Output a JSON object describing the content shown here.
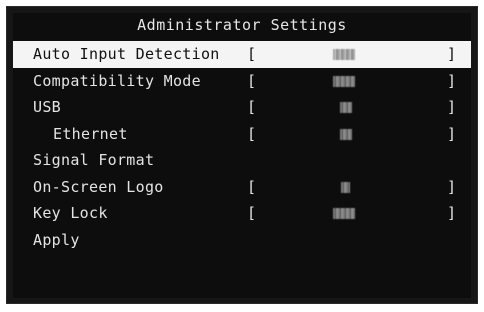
{
  "title": "Administrator Settings",
  "brackets": {
    "open": "[",
    "close": "]"
  },
  "items": [
    {
      "label": "Auto Input Detection",
      "has_value": true,
      "selected": true,
      "indent": false,
      "glyph": "wide"
    },
    {
      "label": "Compatibility Mode",
      "has_value": true,
      "selected": false,
      "indent": false,
      "glyph": "wide"
    },
    {
      "label": "USB",
      "has_value": true,
      "selected": false,
      "indent": false,
      "glyph": "narrow"
    },
    {
      "label": "Ethernet",
      "has_value": true,
      "selected": false,
      "indent": true,
      "glyph": "narrow"
    },
    {
      "label": "Signal Format",
      "has_value": false,
      "selected": false,
      "indent": false,
      "glyph": ""
    },
    {
      "label": "On-Screen Logo",
      "has_value": true,
      "selected": false,
      "indent": false,
      "glyph": "tiny"
    },
    {
      "label": "Key Lock",
      "has_value": true,
      "selected": false,
      "indent": false,
      "glyph": "wide"
    },
    {
      "label": "Apply",
      "has_value": false,
      "selected": false,
      "indent": false,
      "glyph": ""
    }
  ],
  "colors": {
    "background": "#0d0d0d",
    "text": "#e4e4e4",
    "highlight": "#f4f4f4",
    "highlight_text": "#111111"
  }
}
